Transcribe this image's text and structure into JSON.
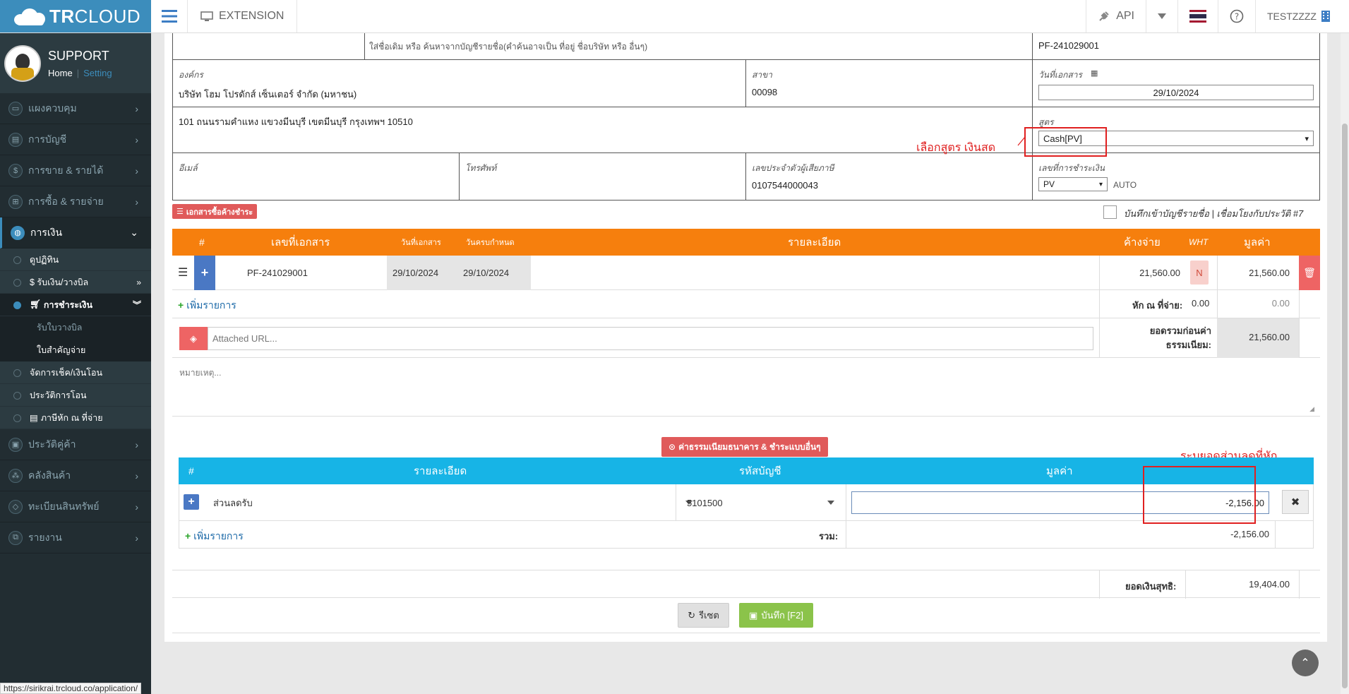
{
  "topbar": {
    "brand_bold": "TR",
    "brand_rest": "CLOUD",
    "extension_label": "EXTENSION",
    "api_label": "API",
    "user_label": "TESTZZZZ"
  },
  "sidebar": {
    "user_name": "SUPPORT",
    "home_link": "Home",
    "setting_link": "Setting",
    "items": [
      {
        "label": "แผงควบคุม",
        "icon": "desktop-icon"
      },
      {
        "label": "การบัญชี",
        "icon": "book-icon"
      },
      {
        "label": "การขาย & รายได้",
        "icon": "dollar-icon"
      },
      {
        "label": "การซื้อ & รายจ่าย",
        "icon": "cart-icon"
      },
      {
        "label": "การเงิน",
        "icon": "globe-icon"
      },
      {
        "label": "ประวัติคู่ค้า",
        "icon": "contact-icon"
      },
      {
        "label": "คลังสินค้า",
        "icon": "cubes-icon"
      },
      {
        "label": "ทะเบียนสินทรัพย์",
        "icon": "diamond-icon"
      },
      {
        "label": "รายงาน",
        "icon": "copy-icon"
      }
    ],
    "finance_sub": [
      {
        "label": "ดูปฏิทิน"
      },
      {
        "label": "$ รับเงิน/วางบิล"
      },
      {
        "label": "การชำระเงิน"
      },
      {
        "label": "รับใบวางบิล"
      },
      {
        "label": "ใบสำคัญจ่าย"
      },
      {
        "label": "จัดการเช็ค/เงินโอน"
      },
      {
        "label": "ประวัติการโอน"
      },
      {
        "label": "ภาษีหัก ณ ที่จ่าย"
      }
    ]
  },
  "header_form": {
    "contact_hint": "ใส่ชื่อเดิม หรือ ค้นหาจากบัญชีรายชื่อ(คำค้นอาจเป็น ที่อยู่ ชื่อบริษัท หรือ อื่นๆ)",
    "doc_number": "PF-241029001",
    "org_label": "องค์กร",
    "org_value": "บริษัท โฮม โปรดักส์ เซ็นเตอร์ จำกัด (มหาชน)",
    "branch_label": "สาขา",
    "branch_value": "00098",
    "doc_date_label": "วันที่เอกสาร",
    "doc_date_value": "29/10/2024",
    "address_value": "101 ถนนรามคำแหง แขวงมีนบุรี เขตมีนบุรี กรุงเทพฯ 10510",
    "formula_label": "สูตร",
    "formula_value": "Cash[PV]",
    "formula_annotation": "เลือกสูตร เงินสด",
    "email_label": "อีเมล์",
    "phone_label": "โทรศัพท์",
    "tax_id_label": "เลขประจำตัวผู้เสียภาษี",
    "tax_id_value": "0107544000043",
    "pay_no_label": "เลขที่การชำระเงิน",
    "pay_no_prefix": "PV",
    "pay_no_auto": "AUTO"
  },
  "docs_badge": "เอกสารซื้อค้างชำระ",
  "record_option": "บันทึกเข้าบัญชีรายชื่อ | เชื่อมโยงกับประวัติ #7",
  "items_table": {
    "headers": {
      "num": "#",
      "doc_no": "เลขที่เอกสาร",
      "doc_date": "วันที่เอกสาร",
      "due_date": "วันครบกำหนด",
      "detail": "รายละเอียด",
      "outstanding": "ค้างจ่าย",
      "wht": "WHT",
      "amount": "มูลค่า"
    },
    "rows": [
      {
        "doc_no": "PF-241029001",
        "doc_date": "29/10/2024",
        "due_date": "29/10/2024",
        "outstanding": "21,560.00",
        "wht": "N",
        "amount": "21,560.00"
      }
    ],
    "add_item": "เพิ่มรายการ",
    "wht_total_label": "หัก ณ ที่จ่าย:",
    "wht_total_value": "0.00",
    "wht_total_amount": "0.00",
    "attached_url_placeholder": "Attached URL...",
    "subtotal_label_1": "ยอดรวมก่อนค่า",
    "subtotal_label_2": "ธรรมเนียม:",
    "subtotal_value": "21,560.00",
    "note_placeholder": "หมายเหตุ..."
  },
  "fees": {
    "badge": "ค่าธรรมเนียมธนาคาร & ชำระแบบอื่นๆ",
    "annotation": "ระบุยอดส่วนลดที่หัก",
    "headers": {
      "num": "#",
      "detail": "รายละเอียด",
      "account": "รหัสบัญชี",
      "amount": "มูลค่า"
    },
    "rows": [
      {
        "detail": "ส่วนลดรับ",
        "account": "5101500",
        "amount": "-2,156.00"
      }
    ],
    "add_item": "เพิ่มรายการ",
    "total_label": "รวม:",
    "total_value": "-2,156.00"
  },
  "net": {
    "label": "ยอดเงินสุทธิ:",
    "value": "19,404.00"
  },
  "buttons": {
    "reset": "รีเซต",
    "save": "บันทึก [F2]"
  },
  "status_url": "https://sirikrai.trcloud.co/application/"
}
